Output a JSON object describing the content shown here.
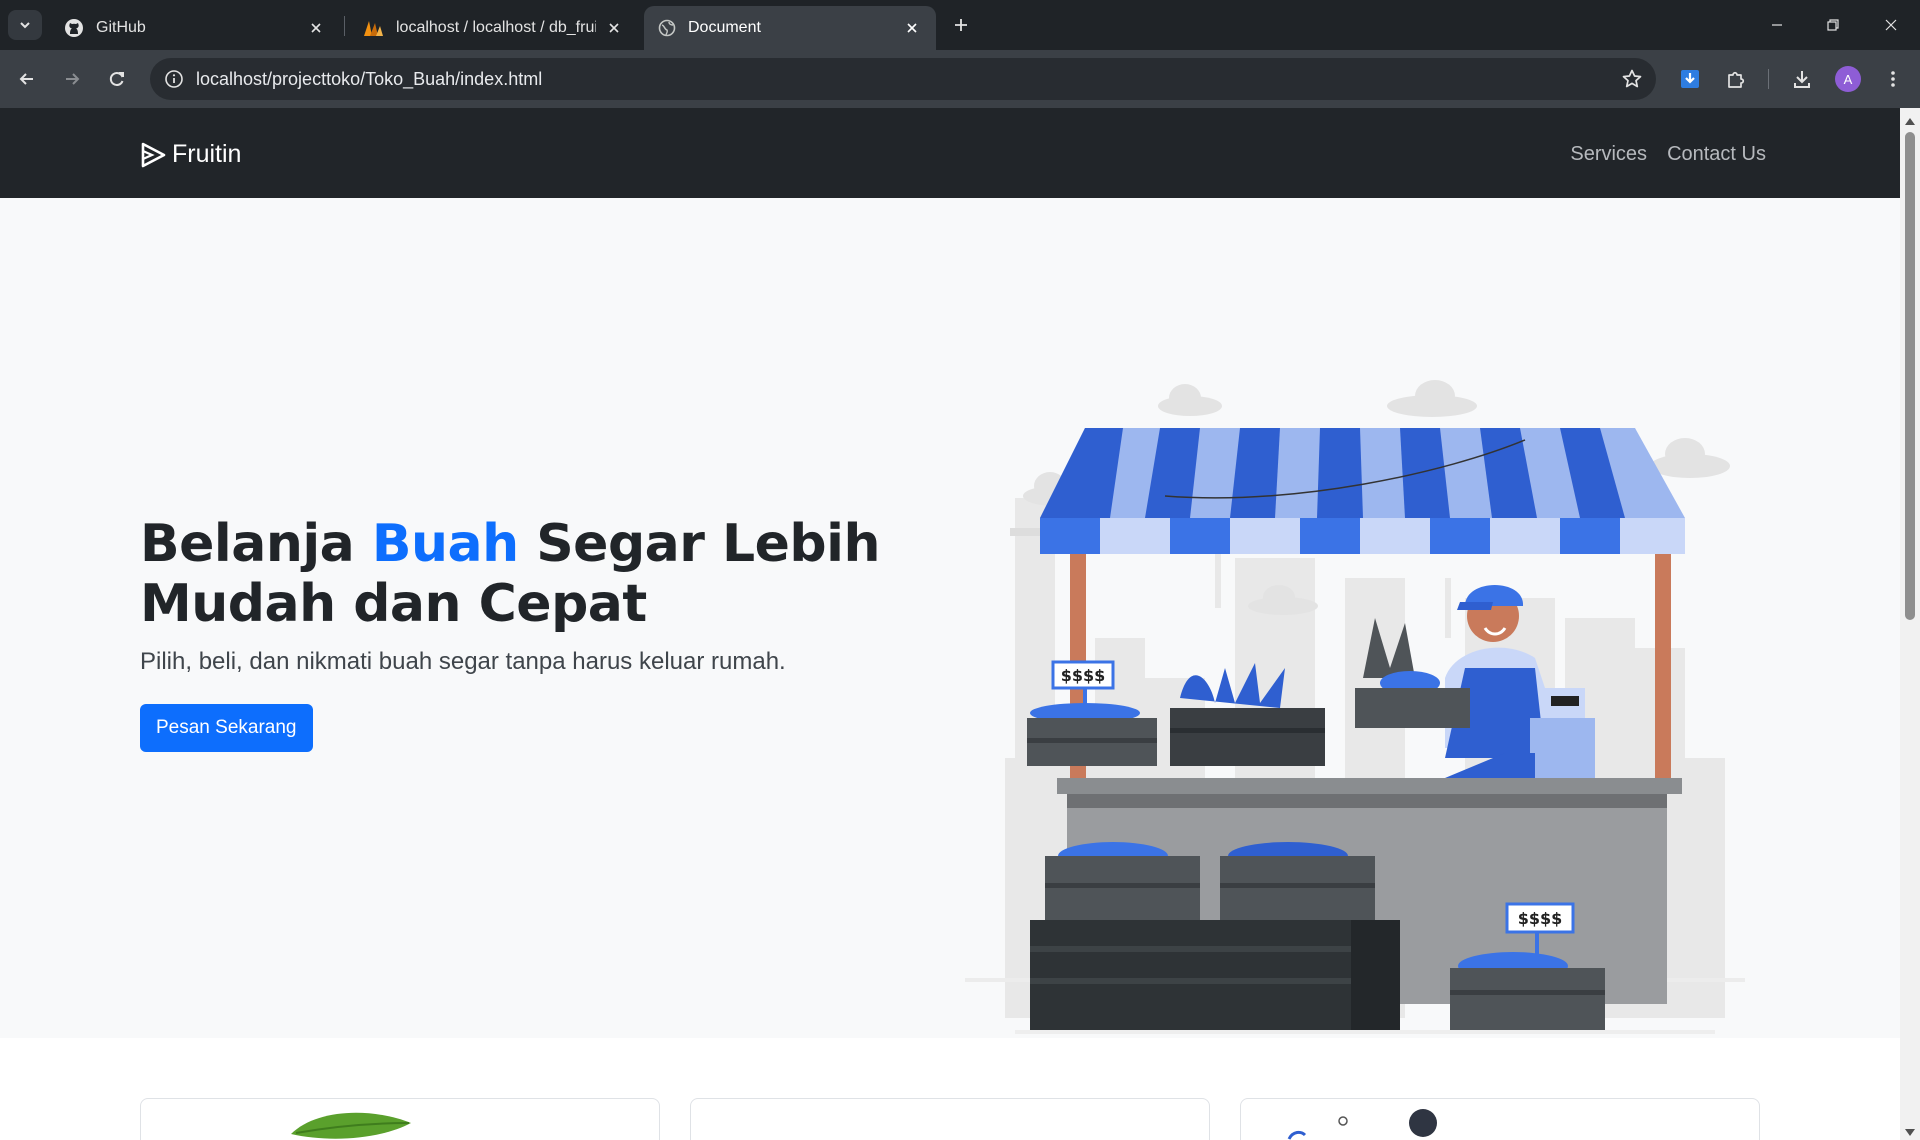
{
  "browser": {
    "tabs": [
      {
        "title": "GitHub",
        "icon": "github-icon",
        "active": false
      },
      {
        "title": "localhost / localhost / db_fruitin",
        "icon": "phpmyadmin-icon",
        "active": false
      },
      {
        "title": "Document",
        "icon": "globe-icon",
        "active": true
      }
    ],
    "url": "localhost/projecttoko/Toko_Buah/index.html",
    "profile_initial": "A"
  },
  "site": {
    "brand": "Fruitin",
    "nav": [
      "Services",
      "Contact Us"
    ],
    "hero": {
      "title_pre": "Belanja ",
      "title_accent": "Buah",
      "title_post": " Segar Lebih Mudah dan Cepat",
      "subtitle": "Pilih, beli, dan nikmati buah segar tanpa harus keluar rumah.",
      "cta": "Pesan Sekarang",
      "price_tag_1": "$$$$",
      "price_tag_2": "$$$$"
    },
    "colors": {
      "accent": "#0d6efd",
      "navbar": "#212529",
      "hero_bg": "#f8f9fa",
      "awning_dark": "#2f5fd0",
      "awning_light": "#9db7ef"
    }
  }
}
